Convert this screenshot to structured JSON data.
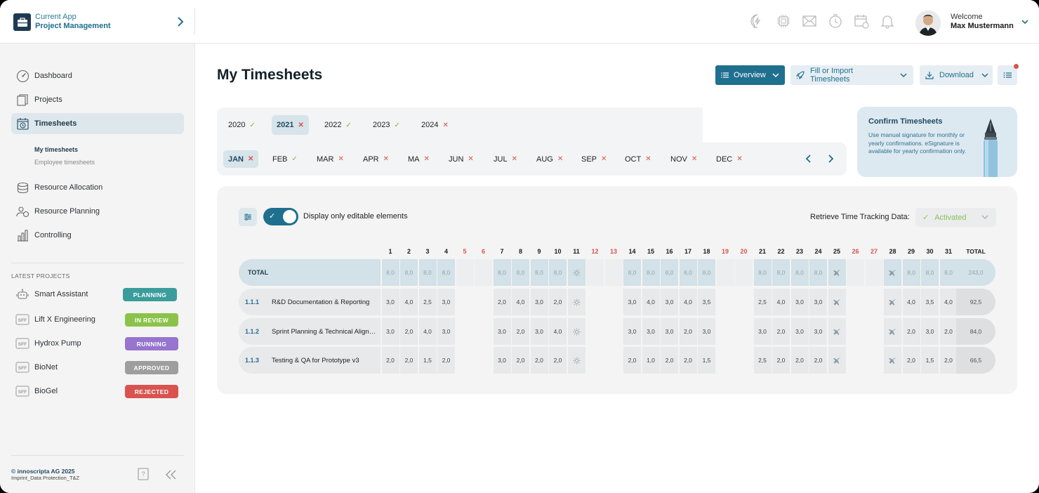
{
  "app": {
    "subtitle": "Current App",
    "name": "Project Management"
  },
  "topbar": {
    "icons": [
      "chat-bolt-icon",
      "chip-icon",
      "mail-icon",
      "clock-icon",
      "calendar-icon",
      "bell-icon"
    ],
    "welcome": "Welcome",
    "user_name": "Max Mustermann"
  },
  "sidebar": {
    "nav": [
      {
        "label": "Dashboard",
        "icon": "gauge-icon"
      },
      {
        "label": "Projects",
        "icon": "documents-icon"
      },
      {
        "label": "Timesheets",
        "icon": "timesheet-icon",
        "active": true
      },
      {
        "label": "Resource Allocation",
        "icon": "coins-icon"
      },
      {
        "label": "Resource Planning",
        "icon": "people-icon"
      },
      {
        "label": "Controlling",
        "icon": "bar-chart-icon"
      }
    ],
    "sub_nav": [
      "My timesheets",
      "Employee timesheets"
    ],
    "latest_title": "LATEST PROJECTS",
    "projects": [
      {
        "name": "Smart Assistant",
        "status": "PLANNING",
        "color": "#3a9d9b",
        "icon": "robot-icon"
      },
      {
        "name": "Lift X Engineering",
        "status": "IN REVIEW",
        "color": "#8bc34a",
        "icon": "sff-icon"
      },
      {
        "name": "Hydrox Pump",
        "status": "RUNNING",
        "color": "#9575cd",
        "icon": "sff-icon"
      },
      {
        "name": "BioNet",
        "status": "APPROVED",
        "color": "#9e9e9e",
        "icon": "sff-icon"
      },
      {
        "name": "BioGel",
        "status": "REJECTED",
        "color": "#d9534f",
        "icon": "sff-icon"
      }
    ],
    "footer": {
      "copyright": "© innoscripta AG 2025",
      "links": "Imprint_Data Protection_T&Z"
    }
  },
  "main": {
    "title": "My Timesheets",
    "buttons": {
      "overview": "Overview",
      "fill": "Fill or Import Timesheets",
      "download": "Download"
    },
    "years": [
      {
        "label": "2020",
        "ok": true
      },
      {
        "label": "2021",
        "ok": false,
        "selected": true
      },
      {
        "label": "2022",
        "ok": true
      },
      {
        "label": "2023",
        "ok": true
      },
      {
        "label": "2024",
        "ok": false
      }
    ],
    "months": [
      {
        "label": "JAN",
        "ok": false,
        "selected": true
      },
      {
        "label": "FEB",
        "ok": true
      },
      {
        "label": "MAR",
        "ok": false
      },
      {
        "label": "APR",
        "ok": false
      },
      {
        "label": "MA",
        "ok": false
      },
      {
        "label": "JUN",
        "ok": false
      },
      {
        "label": "JUL",
        "ok": false
      },
      {
        "label": "AUG",
        "ok": false
      },
      {
        "label": "SEP",
        "ok": false
      },
      {
        "label": "OCT",
        "ok": false
      },
      {
        "label": "NOV",
        "ok": false
      },
      {
        "label": "DEC",
        "ok": false
      }
    ],
    "confirm": {
      "title": "Confirm Timesheets",
      "text": "Use manual signature for monthly or yearly confirmations. eSignature is available for yearly confirmation only."
    },
    "toggle_label": "Display only editable elements",
    "retrieve_label": "Retrieve Time Tracking Data:",
    "retrieve_value": "Activated",
    "table": {
      "days": [
        "1",
        "2",
        "3",
        "4",
        "5",
        "6",
        "7",
        "8",
        "9",
        "10",
        "11",
        "12",
        "13",
        "14",
        "15",
        "16",
        "17",
        "18",
        "19",
        "20",
        "21",
        "22",
        "23",
        "24",
        "25",
        "26",
        "27",
        "28",
        "29",
        "30",
        "31"
      ],
      "weekend_days": [
        5,
        6,
        12,
        13,
        19,
        20,
        26,
        27
      ],
      "total_header": "TOTAL",
      "rows": [
        {
          "code": "",
          "name": "TOTAL",
          "type": "total",
          "cells": [
            "8,0",
            "8,0",
            "8,0",
            "8,0",
            "",
            "",
            "8,0",
            "8,0",
            "8,0",
            "8,0",
            "holiday",
            "",
            "",
            "8,0",
            "8,0",
            "8,0",
            "8,0",
            "8,0",
            "",
            "",
            "8,0",
            "8,0",
            "8,0",
            "8,0",
            "vacation",
            "",
            "",
            "vacation",
            "8,0",
            "8,0",
            "8,0"
          ],
          "total": "243,0"
        },
        {
          "code": "1.1.1",
          "name": "R&D Documentation & Reporting",
          "type": "task",
          "cells": [
            "3,0",
            "4,0",
            "2,5",
            "3,0",
            "",
            "",
            "2,0",
            "4,0",
            "3,0",
            "2,0",
            "holiday",
            "",
            "",
            "3,0",
            "4,0",
            "3,0",
            "4,0",
            "3,5",
            "",
            "",
            "2,5",
            "4,0",
            "3,0",
            "3,0",
            "vacation",
            "",
            "",
            "vacation",
            "4,0",
            "3,5",
            "4,0"
          ],
          "total": "92,5"
        },
        {
          "code": "1.1.2",
          "name": "Sprint Planning & Technical Alignment",
          "type": "task",
          "cells": [
            "3,0",
            "2,0",
            "4,0",
            "3,0",
            "",
            "",
            "3,0",
            "2,0",
            "3,0",
            "4,0",
            "holiday",
            "",
            "",
            "3,0",
            "3,0",
            "3,0",
            "2,0",
            "3,0",
            "",
            "",
            "3,0",
            "2,0",
            "3,0",
            "3,0",
            "vacation",
            "",
            "",
            "vacation",
            "2,0",
            "3,0",
            "2,0"
          ],
          "total": "84,0"
        },
        {
          "code": "1.1.3",
          "name": "Testing & QA for Prototype v3",
          "type": "task",
          "cells": [
            "2,0",
            "2,0",
            "1,5",
            "2,0",
            "",
            "",
            "3,0",
            "2,0",
            "2,0",
            "2,0",
            "holiday",
            "",
            "",
            "2,0",
            "1,0",
            "2,0",
            "2,0",
            "1,5",
            "",
            "",
            "2,5",
            "2,0",
            "2,0",
            "2,0",
            "vacation",
            "",
            "",
            "vacation",
            "2,0",
            "1,5",
            "2,0"
          ],
          "total": "66,5"
        }
      ]
    }
  },
  "colors": {
    "primary": "#1f6f8f",
    "ok": "#7ab34a",
    "error": "#d9534f"
  }
}
